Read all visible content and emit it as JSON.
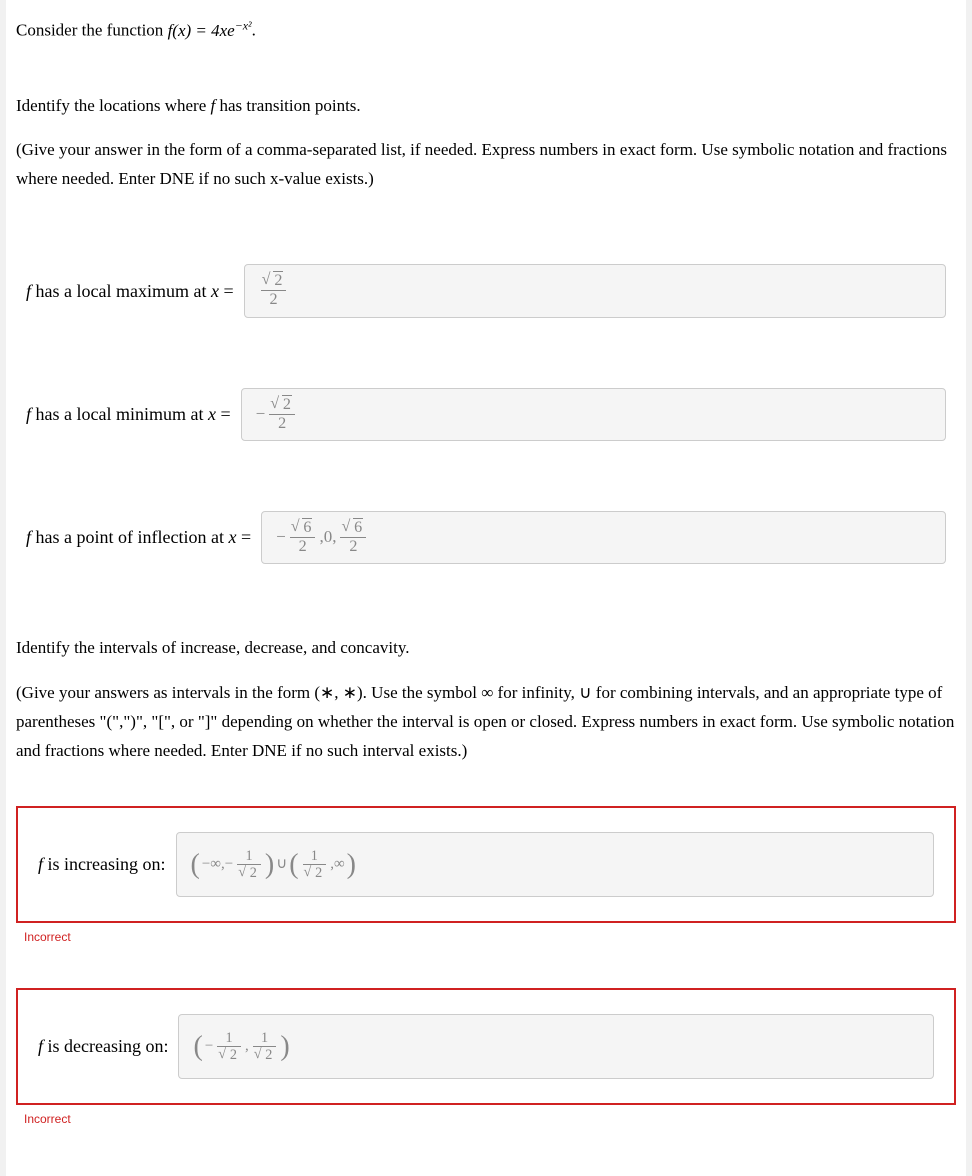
{
  "intro": {
    "prefix": "Consider the function ",
    "func_lhs": "f(x) = 4xe",
    "func_exp": "−x²",
    "suffix": "."
  },
  "part1": {
    "prompt": "Identify the locations where f has transition points.",
    "instructions": "(Give your answer in the form of a comma-separated list, if needed. Express numbers in exact form. Use symbolic notation and fractions where needed. Enter DNE if no such x-value exists.)"
  },
  "answers": {
    "maxLabel": "f has a local maximum at x =",
    "minLabel": "f has a local minimum at x =",
    "inflLabel": "f has a point of inflection at x ="
  },
  "part2": {
    "prompt": "Identify the intervals of increase, decrease, and concavity.",
    "instructions": "(Give your answers as intervals in the form (∗, ∗). Use the symbol ∞ for infinity, ∪ for combining intervals, and an appropriate type of parentheses \"(\",\")\", \"[\", or \"]\" depending on whether the interval is open or closed. Express numbers in exact form. Use symbolic notation and fractions where needed. Enter DNE if no such interval exists.)"
  },
  "intervals": {
    "incLabel": "f is increasing on:",
    "decLabel": "f is decreasing on:"
  },
  "feedback": {
    "incorrect": "Incorrect"
  }
}
